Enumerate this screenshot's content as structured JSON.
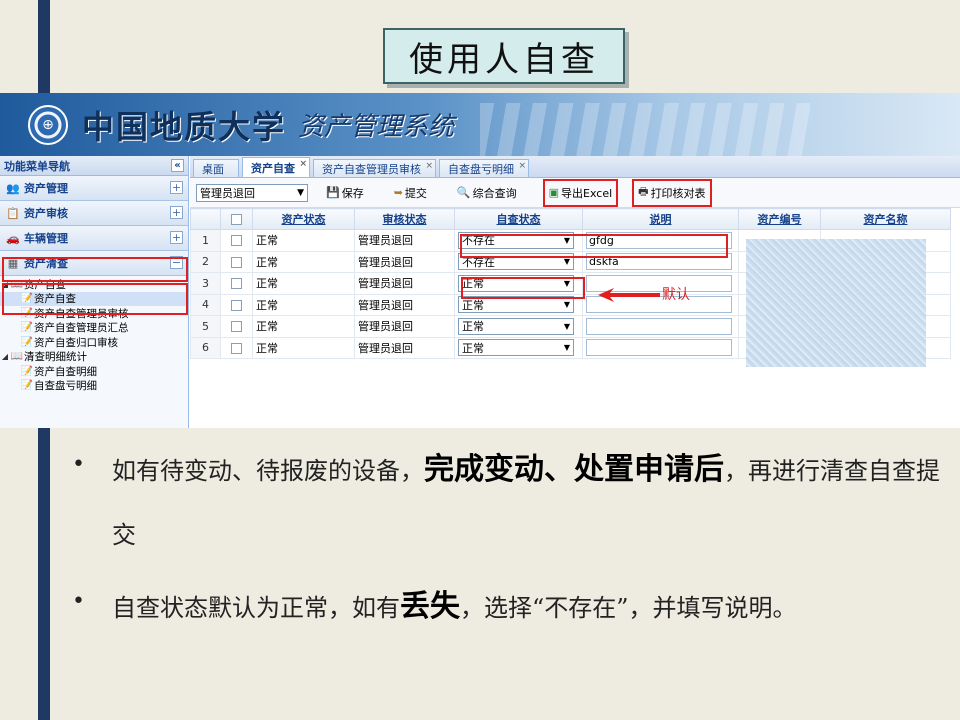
{
  "slide": {
    "title": "使用人自查"
  },
  "app": {
    "banner_name": "中国地质大学",
    "banner_sub": "资产管理系统",
    "sidebar": {
      "header": "功能菜单导航",
      "collapse_icon": "«",
      "sections": [
        {
          "label": "资产管理",
          "icon": "users-icon",
          "toggle": "+"
        },
        {
          "label": "资产审核",
          "icon": "clipboard-icon",
          "toggle": "+"
        },
        {
          "label": "车辆管理",
          "icon": "car-icon",
          "toggle": "+"
        },
        {
          "label": "资产清查",
          "icon": "calculator-icon",
          "toggle": "−"
        }
      ],
      "tree": [
        {
          "label": "资产自查",
          "level": 0,
          "type": "folder"
        },
        {
          "label": "资产自查",
          "level": 1,
          "type": "leaf",
          "selected": true
        },
        {
          "label": "资产自查管理员审核",
          "level": 1,
          "type": "leaf"
        },
        {
          "label": "资产自查管理员汇总",
          "level": 1,
          "type": "leaf"
        },
        {
          "label": "资产自查归口审核",
          "level": 1,
          "type": "leaf"
        },
        {
          "label": "清查明细统计",
          "level": 0,
          "type": "folder"
        },
        {
          "label": "资产自查明细",
          "level": 1,
          "type": "leaf"
        },
        {
          "label": "自查盘亏明细",
          "level": 1,
          "type": "leaf"
        }
      ]
    },
    "tabs": [
      {
        "label": "桌面",
        "closable": false,
        "active": false
      },
      {
        "label": "资产自查",
        "closable": true,
        "active": true
      },
      {
        "label": "资产自查管理员审核",
        "closable": true,
        "active": false
      },
      {
        "label": "自查盘亏明细",
        "closable": true,
        "active": false
      }
    ],
    "tab_close": "×",
    "toolbar": {
      "filter_value": "管理员退回",
      "save": "保存",
      "submit": "提交",
      "query": "综合查询",
      "export": "导出Excel",
      "print": "打印核对表"
    },
    "grid": {
      "columns": [
        "资产状态",
        "审核状态",
        "自查状态",
        "说明",
        "资产编号",
        "资产名称"
      ],
      "rows": [
        {
          "n": "1",
          "asset_status": "正常",
          "audit_status": "管理员退回",
          "check_status": "不存在",
          "note": "gfdg"
        },
        {
          "n": "2",
          "asset_status": "正常",
          "audit_status": "管理员退回",
          "check_status": "不存在",
          "note": "dskfa"
        },
        {
          "n": "3",
          "asset_status": "正常",
          "audit_status": "管理员退回",
          "check_status": "正常",
          "note": ""
        },
        {
          "n": "4",
          "asset_status": "正常",
          "audit_status": "管理员退回",
          "check_status": "正常",
          "note": ""
        },
        {
          "n": "5",
          "asset_status": "正常",
          "audit_status": "管理员退回",
          "check_status": "正常",
          "note": ""
        },
        {
          "n": "6",
          "asset_status": "正常",
          "audit_status": "管理员退回",
          "check_status": "正常",
          "note": ""
        }
      ]
    },
    "annotation_default": "默认"
  },
  "bullets": {
    "b1_pre": "如有待变动、待报废的设备，",
    "b1_bold": "完成变动、处置申请后",
    "b1_post": "，再进行清查自查提交",
    "b2_pre": "自查状态默认为正常，如有",
    "b2_bold": "丢失",
    "b2_post": "，选择“不存在”，并填写说明。"
  },
  "colors": {
    "accent_red": "#e02020",
    "strip_navy": "#1f3864",
    "header_blue": "#15428b"
  }
}
